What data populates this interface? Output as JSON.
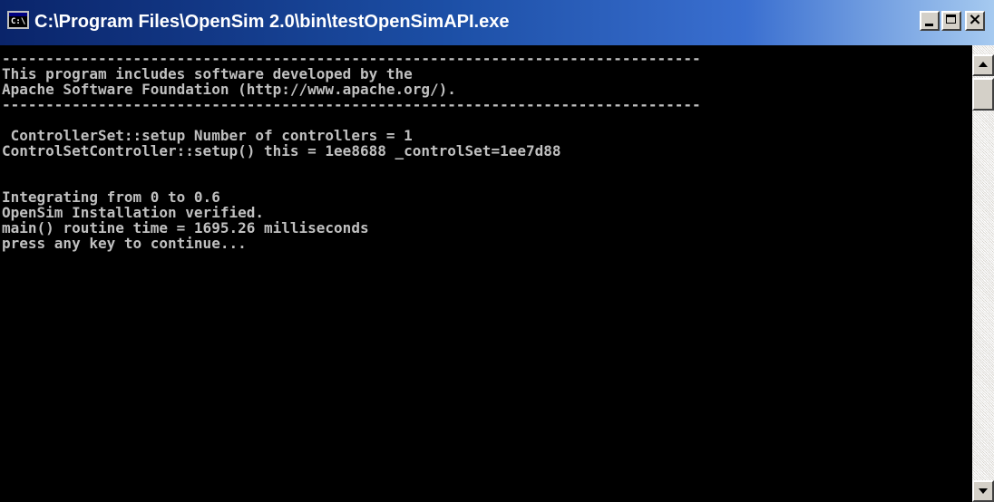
{
  "window": {
    "title": "C:\\Program Files\\OpenSim 2.0\\bin\\testOpenSimAPI.exe",
    "icon": "cmd-console-icon",
    "icon_text": "C:\\",
    "buttons": {
      "minimize_icon": "minimize-icon",
      "maximize_icon": "maximize-icon",
      "close_label": "×"
    }
  },
  "console": {
    "lines": [
      "--------------------------------------------------------------------------------",
      "This program includes software developed by the",
      "Apache Software Foundation (http://www.apache.org/).",
      "--------------------------------------------------------------------------------",
      "",
      " ControllerSet::setup Number of controllers = 1",
      "ControlSetController::setup() this = 1ee8688 _controlSet=1ee7d88",
      "",
      "",
      "Integrating from 0 to 0.6",
      "OpenSim Installation verified.",
      "main() routine time = 1695.26 milliseconds",
      "press any key to continue..."
    ],
    "text_color": "#c0c0c0",
    "background_color": "#000000"
  },
  "scrollbar": {
    "up_icon": "scroll-up-arrow-icon",
    "down_icon": "scroll-down-arrow-icon"
  }
}
